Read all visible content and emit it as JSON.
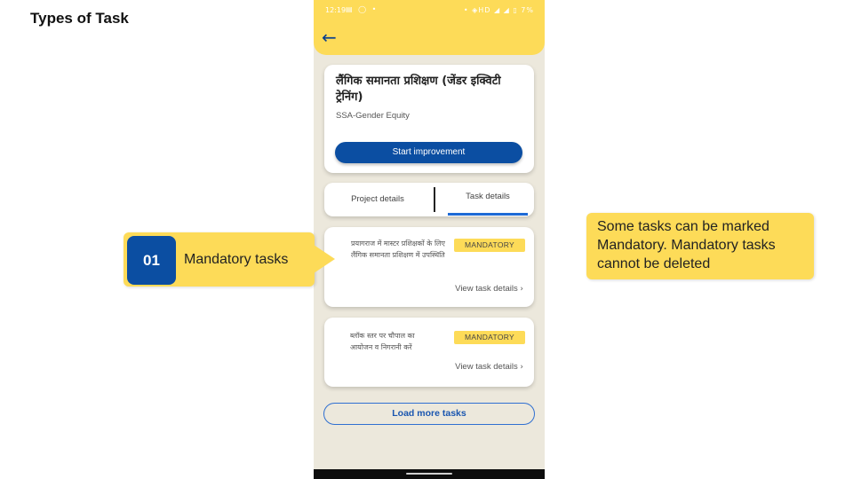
{
  "slide": {
    "title": "Types of Task"
  },
  "status_bar": {
    "time": "12:19",
    "left_icons": "▤ ◯ •",
    "right_icons": "• ◈HD ◢ ◢ ▯ 7%"
  },
  "app": {
    "back_icon": "arrow-left-icon",
    "project": {
      "title": "लैंगिक समानता प्रशिक्षण (जेंडर इक्विटी ट्रेनिंग)",
      "subtitle": "SSA-Gender Equity",
      "start_button": "Start improvement"
    },
    "tabs": [
      {
        "label": "Project details",
        "active": false
      },
      {
        "label": "Task details",
        "active": true
      }
    ],
    "tasks": [
      {
        "text": "प्रयागराज में मास्टर प्रशिक्षकों के लिए लैंगिक समानता प्रशिक्षण में उपस्थिति",
        "badge": "MANDATORY",
        "link": "View task details"
      },
      {
        "text": "ब्लॉक स्तर पर चौपाल का आयोजन व निगरानी करें",
        "badge": "MANDATORY",
        "link": "View task details"
      }
    ],
    "load_more": "Load more tasks"
  },
  "callouts": {
    "left": {
      "number": "01",
      "label": "Mandatory tasks"
    },
    "right": {
      "text": "Some tasks can be marked Mandatory. Mandatory tasks cannot be deleted"
    }
  },
  "colors": {
    "accent_yellow": "#fddb58",
    "primary_blue": "#0b4ea2",
    "tab_underline": "#1e6ad6",
    "phone_background": "#ece8dc"
  }
}
